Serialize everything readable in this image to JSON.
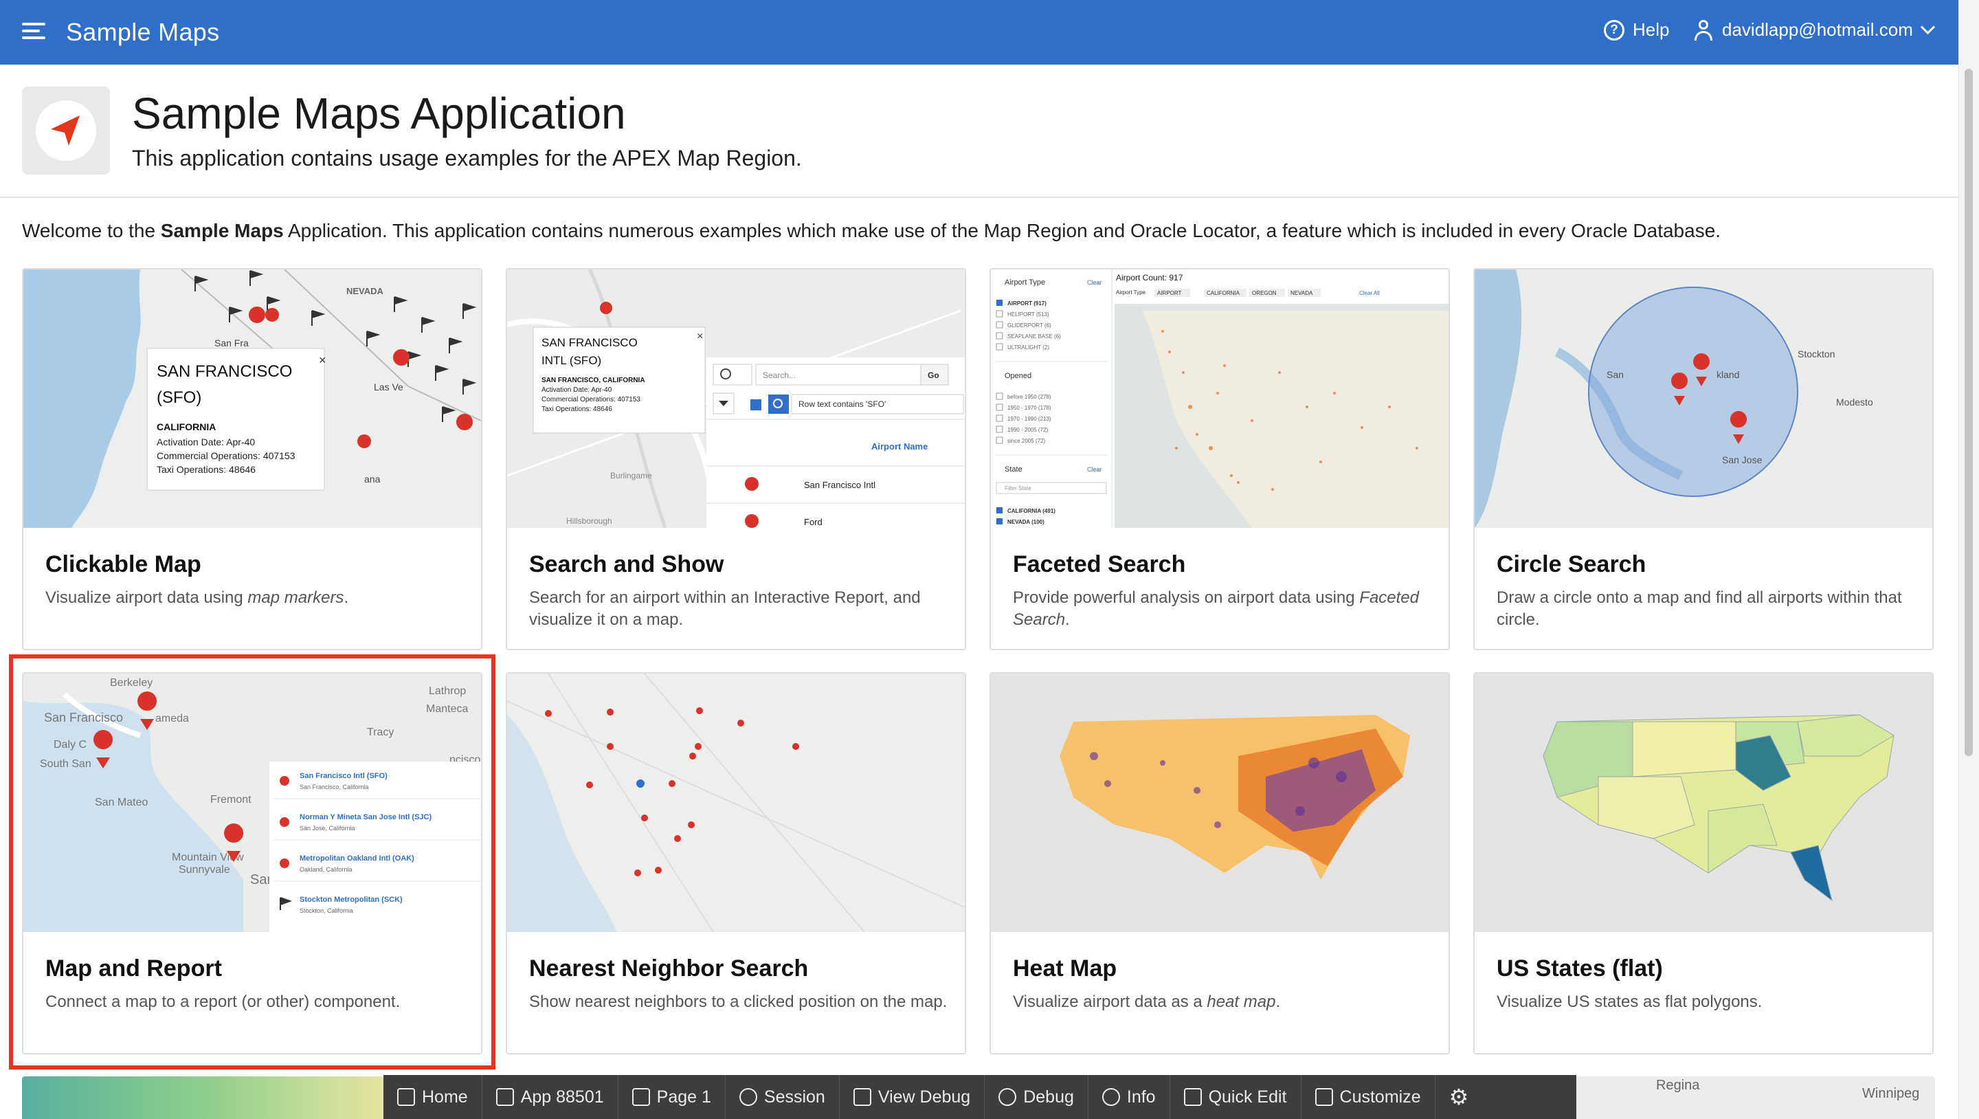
{
  "header": {
    "app_title": "Sample Maps",
    "help_label": "Help",
    "user_label": "davidlapp@hotmail.com"
  },
  "hero": {
    "title": "Sample Maps Application",
    "subtitle": "This application contains usage examples for the APEX Map Region."
  },
  "welcome": {
    "prefix": "Welcome to the ",
    "bold": "Sample Maps",
    "suffix": " Application. This application contains numerous examples which make use of the Map Region and Oracle Locator, a feature which is included in every Oracle Database."
  },
  "cards": [
    {
      "title": "Clickable Map",
      "desc_a": "Visualize airport data using ",
      "desc_em": "map markers",
      "desc_b": ".",
      "thumb": {
        "popup_title_1": "SAN FRANCISCO",
        "popup_title_2": "(SFO)",
        "state": "CALIFORNIA",
        "line1": "Activation Date: Apr-40",
        "line2": "Commercial Operations: 407153",
        "line3": "Taxi Operations: 48646",
        "map_labels": [
          "NEVADA",
          "San Fra",
          "Las Ve",
          "ana"
        ]
      }
    },
    {
      "title": "Search and Show",
      "desc_a": "Search for an airport within an Interactive Report, and visualize it on a map.",
      "desc_em": "",
      "desc_b": "",
      "thumb": {
        "popup_title_1": "SAN FRANCISCO",
        "popup_title_2": "INTL (SFO)",
        "sub": "SAN FRANCISCO, CALIFORNIA",
        "line1": "Activation Date: Apr-40",
        "line2": "Commercial Operations: 407153",
        "line3": "Taxi Operations: 48646",
        "search_placeholder": "Search...",
        "go_label": "Go",
        "filter_text": "Row text contains 'SFO'",
        "column_header": "Airport Name",
        "row1": "San Francisco Intl",
        "row2": "Ford",
        "map_labels": [
          "Burlingame",
          "Hillsborough"
        ]
      }
    },
    {
      "title": "Faceted Search",
      "desc_a": "Provide powerful analysis on airport data using ",
      "desc_em": "Faceted Search",
      "desc_b": ".",
      "thumb": {
        "facet1": "Airport Type",
        "facet1_items": [
          "AIRPORT (917)",
          "HELIPORT (513)",
          "GLIDERPORT (6)",
          "SEAPLANE BASE (6)",
          "ULTRALIGHT (2)"
        ],
        "facet2": "Opened",
        "facet2_items": [
          "before 1950 (278)",
          "1950 - 1970 (178)",
          "1970 - 1990 (213)",
          "1990 - 2005 (72)",
          "since 2005 (72)"
        ],
        "facet3": "State",
        "facet3_filter": "Filter State",
        "facet3_items": [
          "CALIFORNIA (491)",
          "NEVADA (100)"
        ],
        "count_label": "Airport Count: 917",
        "clear": "Clear",
        "clear_all": "Clear All",
        "chips": [
          "AIRPORT",
          "CALIFORNIA",
          "OREGON",
          "NEVADA"
        ]
      }
    },
    {
      "title": "Circle Search",
      "desc_a": "Draw a circle onto a map and find all airports within that circle.",
      "desc_em": "",
      "desc_b": "",
      "thumb": {
        "map_labels": [
          "San",
          "Stockton",
          "kland",
          "Modesto",
          "San Jose"
        ]
      }
    },
    {
      "title": "Map and Report",
      "desc_a": "Connect a map to a report (or other) component.",
      "desc_em": "",
      "desc_b": "",
      "thumb": {
        "map_labels": [
          "Berkeley",
          "Lathrop",
          "Manteca",
          "San Francisco",
          "ameda",
          "Tracy",
          "Daly C",
          "South San",
          "San Mateo",
          "Fremont",
          "Mountain View",
          "Sunnyvale",
          "San Jos",
          "ncisco"
        ],
        "rows": [
          {
            "name": "San Francisco Intl (SFO)",
            "loc": "San Francisco, California"
          },
          {
            "name": "Norman Y Mineta San Jose Intl (SJC)",
            "loc": "San Jose, California"
          },
          {
            "name": "Metropolitan Oakland Intl (OAK)",
            "loc": "Oakland, California"
          },
          {
            "name": "Stockton Metropolitan (SCK)",
            "loc": "Stockton, California"
          }
        ]
      }
    },
    {
      "title": "Nearest Neighbor Search",
      "desc_a": "Show nearest neighbors to a clicked position on the map.",
      "desc_em": "",
      "desc_b": ""
    },
    {
      "title": "Heat Map",
      "desc_a": "Visualize airport data as a ",
      "desc_em": "heat map",
      "desc_b": "."
    },
    {
      "title": "US States (flat)",
      "desc_a": "Visualize US states as flat polygons.",
      "desc_em": "",
      "desc_b": ""
    }
  ],
  "devbar": {
    "items": [
      {
        "label": "Home",
        "icon": "home-icon"
      },
      {
        "label": "App 88501",
        "icon": "edit-icon"
      },
      {
        "label": "Page 1",
        "icon": "page-icon"
      },
      {
        "label": "Session",
        "icon": "history-icon"
      },
      {
        "label": "View Debug",
        "icon": "external-icon"
      },
      {
        "label": "Debug",
        "icon": "bug-icon"
      },
      {
        "label": "Info",
        "icon": "info-icon"
      },
      {
        "label": "Quick Edit",
        "icon": "quick-edit-icon"
      },
      {
        "label": "Customize",
        "icon": "paint-icon"
      }
    ],
    "settings_icon": "gear-icon"
  },
  "peek": {
    "regina": "Regina",
    "winnipeg": "Winnipeg"
  },
  "colors": {
    "header": "#2f6fc9",
    "highlight": "#e3361d",
    "marker": "#d8322a",
    "devbar": "#3d3d3d"
  }
}
